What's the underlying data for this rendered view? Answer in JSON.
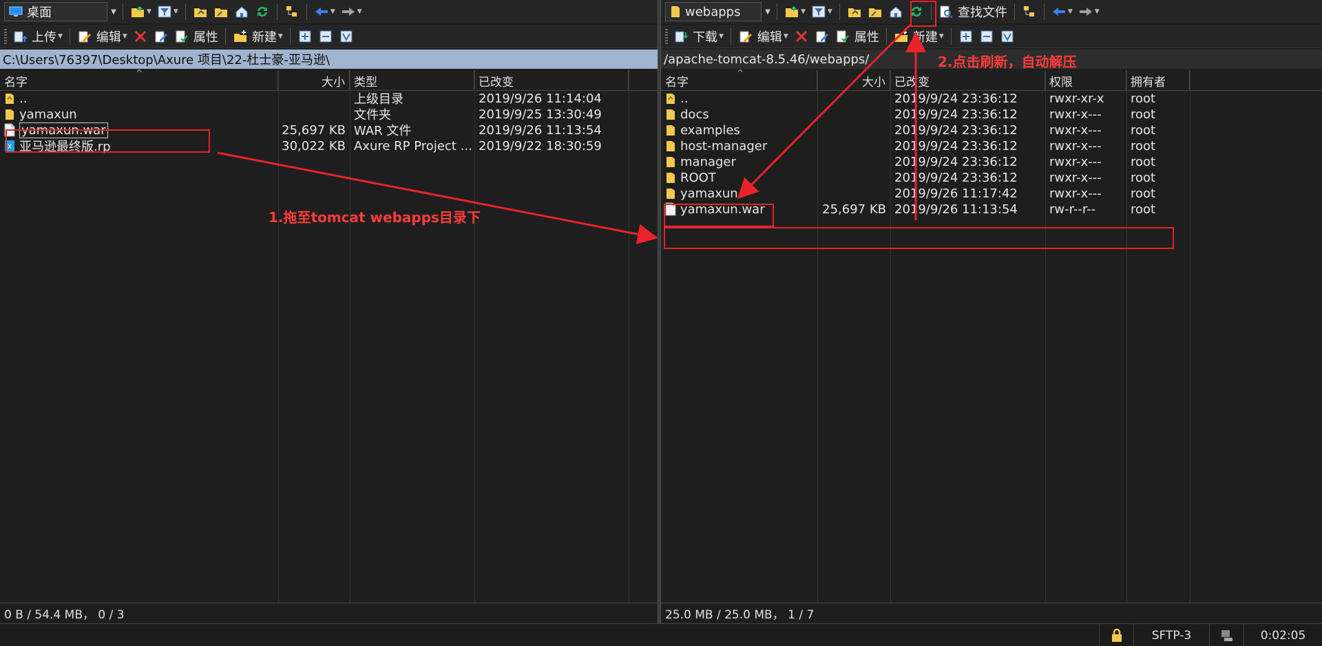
{
  "left": {
    "drive_label": "桌面",
    "upload_label": "上传",
    "edit_label": "编辑",
    "properties_label": "属性",
    "new_label": "新建",
    "path": "C:\\Users\\76397\\Desktop\\Axure 项目\\22-杜士豪-亚马逊\\",
    "columns": {
      "name": "名字",
      "size": "大小",
      "type": "类型",
      "modified": "已改变"
    },
    "files": [
      {
        "name": "..",
        "size": "",
        "type": "上级目录",
        "modified": "2019/9/26  11:14:04",
        "icon": "folder-up-icon"
      },
      {
        "name": "yamaxun",
        "size": "",
        "type": "文件夹",
        "modified": "2019/9/25  13:30:49",
        "icon": "folder-icon"
      },
      {
        "name": "yamaxun.war",
        "size": "25,697 KB",
        "type": "WAR 文件",
        "modified": "2019/9/26  11:13:54",
        "icon": "file-icon"
      },
      {
        "name": "亚马逊最终版.rp",
        "size": "30,022 KB",
        "type": "Axure RP Project ...",
        "modified": "2019/9/22  18:30:59",
        "icon": "axure-file-icon"
      }
    ],
    "status": "0 B / 54.4 MB，  0 / 3"
  },
  "right": {
    "drive_label": "webapps",
    "download_label": "下载",
    "edit_label": "编辑",
    "properties_label": "属性",
    "new_label": "新建",
    "find_label": "查找文件",
    "path": "/apache-tomcat-8.5.46/webapps/",
    "columns": {
      "name": "名字",
      "size": "大小",
      "modified": "已改变",
      "rights": "权限",
      "owner": "拥有者"
    },
    "files": [
      {
        "name": "..",
        "size": "",
        "modified": "2019/9/24 23:36:12",
        "rights": "rwxr-xr-x",
        "owner": "root",
        "icon": "folder-up-icon"
      },
      {
        "name": "docs",
        "size": "",
        "modified": "2019/9/24 23:36:12",
        "rights": "rwxr-x---",
        "owner": "root",
        "icon": "folder-icon"
      },
      {
        "name": "examples",
        "size": "",
        "modified": "2019/9/24 23:36:12",
        "rights": "rwxr-x---",
        "owner": "root",
        "icon": "folder-icon"
      },
      {
        "name": "host-manager",
        "size": "",
        "modified": "2019/9/24 23:36:12",
        "rights": "rwxr-x---",
        "owner": "root",
        "icon": "folder-icon"
      },
      {
        "name": "manager",
        "size": "",
        "modified": "2019/9/24 23:36:12",
        "rights": "rwxr-x---",
        "owner": "root",
        "icon": "folder-icon"
      },
      {
        "name": "ROOT",
        "size": "",
        "modified": "2019/9/24 23:36:12",
        "rights": "rwxr-x---",
        "owner": "root",
        "icon": "folder-icon"
      },
      {
        "name": "yamaxun",
        "size": "",
        "modified": "2019/9/26 11:17:42",
        "rights": "rwxr-x---",
        "owner": "root",
        "icon": "folder-icon"
      },
      {
        "name": "yamaxun.war",
        "size": "25,697 KB",
        "modified": "2019/9/26 11:13:54",
        "rights": "rw-r--r--",
        "owner": "root",
        "icon": "file-icon"
      }
    ],
    "status": "25.0 MB / 25.0 MB，  1 / 7"
  },
  "bottom": {
    "protocol": "SFTP-3",
    "elapsed": "0:02:05"
  },
  "annotations": {
    "step1": "1.拖至tomcat webapps目录下",
    "step2": "2.点击刷新，自动解压"
  },
  "colors": {
    "annotation_red": "#e8232a",
    "path_bar": "#9fb5cf",
    "folder_yellow": "#f2c94c"
  }
}
